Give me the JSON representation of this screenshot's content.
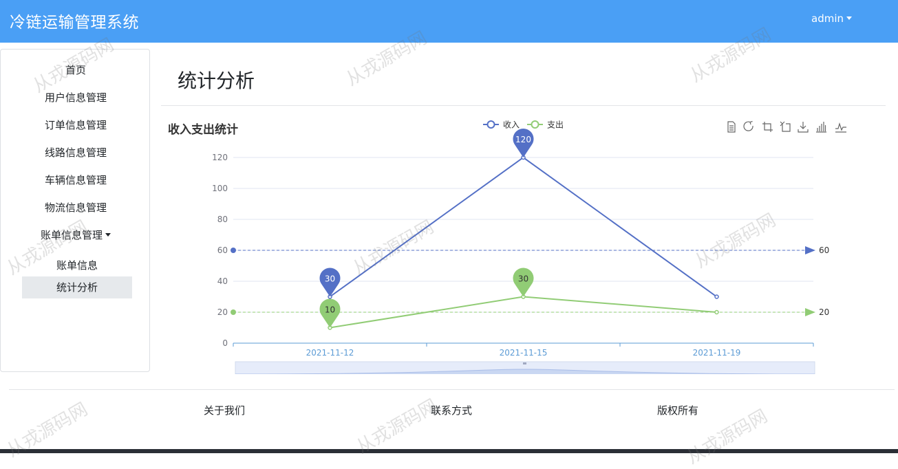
{
  "header": {
    "title": "冷链运输管理系统",
    "user": "admin"
  },
  "sidebar": {
    "items": [
      "首页",
      "用户信息管理",
      "订单信息管理",
      "线路信息管理",
      "车辆信息管理",
      "物流信息管理"
    ],
    "dropdown": "账单信息管理",
    "sub_items": [
      "账单信息",
      "统计分析"
    ]
  },
  "page": {
    "title": "统计分析"
  },
  "chart_data": {
    "type": "line",
    "title": "收入支出统计",
    "categories": [
      "2021-11-12",
      "2021-11-15",
      "2021-11-19"
    ],
    "series": [
      {
        "name": "收入",
        "values": [
          30,
          120,
          30
        ],
        "color": "#5470c6",
        "max_label": "120",
        "min_label": "30",
        "average": 60
      },
      {
        "name": "支出",
        "values": [
          10,
          30,
          20
        ],
        "color": "#91cc75",
        "max_label": "30",
        "min_label": "10",
        "average": 20
      }
    ],
    "ylim": [
      0,
      120
    ],
    "yticks": [
      "0",
      "20",
      "40",
      "60",
      "80",
      "100",
      "120"
    ],
    "average_labels": [
      "60",
      "20"
    ],
    "legend": "top-center",
    "grid": true,
    "toolbox": [
      "data-view-icon",
      "restore-icon",
      "zoom-icon",
      "zoom-reset-icon",
      "save-image-icon",
      "bar-chart-icon",
      "line-chart-icon"
    ]
  },
  "footer": {
    "links": [
      "关于我们",
      "联系方式",
      "版权所有"
    ]
  },
  "watermark": "从戎源码网"
}
